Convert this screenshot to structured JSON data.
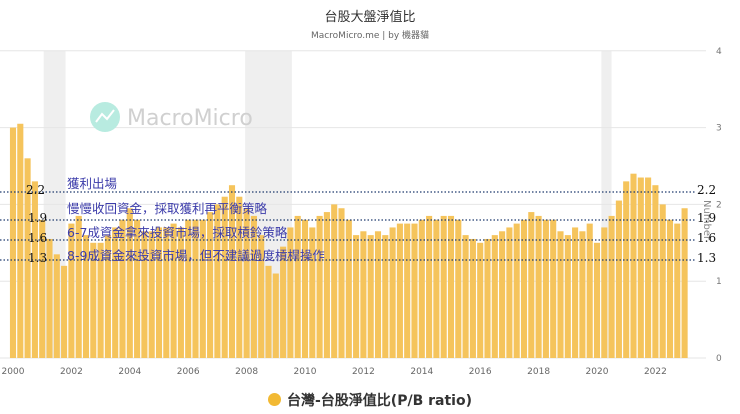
{
  "chart_data": {
    "type": "bar",
    "title": "台股大盤淨值比",
    "subtitle": "MacroMicro.me | by 機器貓",
    "watermark": "MacroMicro",
    "ylabel": "Number",
    "ylim": [
      0,
      4
    ],
    "yticks": [
      "0",
      "1",
      "2",
      "3",
      "4"
    ],
    "xticks": [
      "2000",
      "2002",
      "2004",
      "2006",
      "2008",
      "2010",
      "2012",
      "2014",
      "2016",
      "2018",
      "2020",
      "2022"
    ],
    "frequency": "quarterly (approx.)",
    "start_year": 2000,
    "values": [
      3.0,
      3.05,
      2.6,
      2.3,
      1.8,
      1.55,
      1.35,
      1.2,
      1.75,
      1.85,
      1.6,
      1.5,
      1.5,
      1.6,
      1.7,
      1.8,
      1.95,
      1.8,
      1.65,
      1.65,
      1.7,
      1.7,
      1.75,
      1.7,
      1.8,
      1.8,
      1.8,
      1.9,
      2.0,
      2.1,
      2.25,
      2.1,
      1.95,
      1.85,
      1.6,
      1.2,
      1.1,
      1.45,
      1.7,
      1.85,
      1.8,
      1.7,
      1.85,
      1.9,
      2.0,
      1.95,
      1.8,
      1.6,
      1.65,
      1.6,
      1.65,
      1.6,
      1.7,
      1.75,
      1.75,
      1.75,
      1.8,
      1.85,
      1.8,
      1.85,
      1.85,
      1.8,
      1.6,
      1.55,
      1.5,
      1.55,
      1.6,
      1.65,
      1.7,
      1.75,
      1.8,
      1.9,
      1.85,
      1.8,
      1.8,
      1.65,
      1.6,
      1.7,
      1.65,
      1.75,
      1.5,
      1.7,
      1.85,
      2.05,
      2.3,
      2.4,
      2.35,
      2.35,
      2.25,
      2.0,
      1.8,
      1.75,
      1.95
    ],
    "shaded_periods": [
      [
        2001.05,
        2001.8
      ],
      [
        2007.95,
        2009.55
      ],
      [
        2020.15,
        2020.5
      ]
    ],
    "reference_lines": [
      {
        "value": 2.2,
        "label": "2.2"
      },
      {
        "value": 1.9,
        "label": "1.9"
      },
      {
        "value": 1.6,
        "label": "1.6"
      },
      {
        "value": 1.3,
        "label": "1.3"
      }
    ],
    "annotations": [
      "獲利出場",
      "慢慢收回資金，採取獲利再平衡策略",
      "6-7成資金拿來投資市場，採取槓鈴策略",
      "8-9成資金來投資市場，但不建議過度槓桿操作"
    ],
    "legend": "台灣-台股淨值比(P/B ratio)",
    "colors": {
      "bar": "#f5c45c",
      "shade": "#efefef",
      "ref": "#1f3a6e",
      "annotation": "#3c3caa"
    }
  }
}
